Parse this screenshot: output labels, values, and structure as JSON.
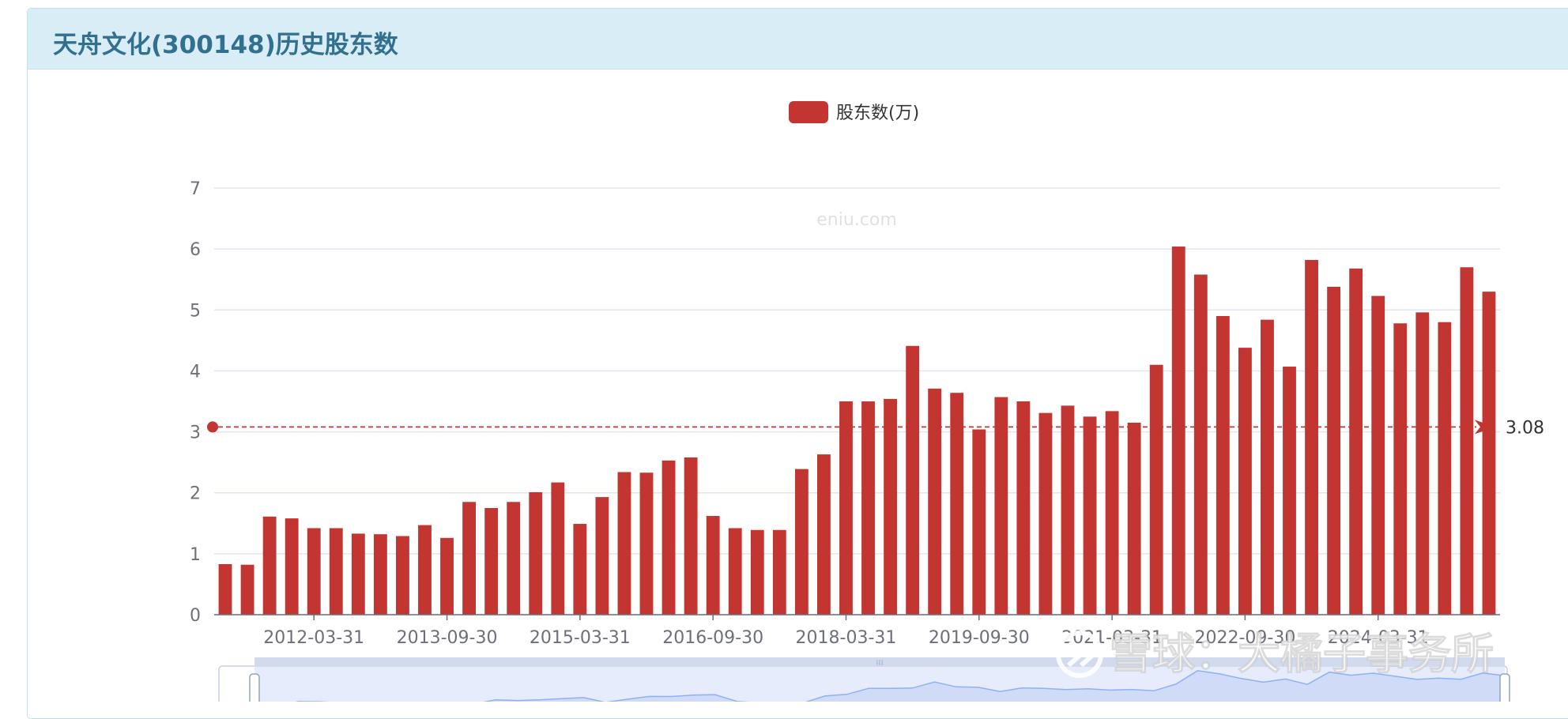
{
  "panel": {
    "title": "天舟文化(300148)历史股东数"
  },
  "watermarks": {
    "site": "eniu.com",
    "xueqiu": "雪球：大橘子事务所"
  },
  "colors": {
    "bar": "#c23531",
    "header_bg": "#d9edf7",
    "title": "#31708f",
    "grid": "#e0e6f1",
    "zoom_fill": "#dde6fa",
    "zoom_line": "#8fb0f7"
  },
  "chart_data": {
    "type": "bar",
    "legend": [
      "股东数(万)"
    ],
    "legend_position": "top-center",
    "ylim": [
      0,
      7
    ],
    "y_ticks": [
      0,
      1,
      2,
      3,
      4,
      5,
      6,
      7
    ],
    "x_tick_labels": [
      "2012-03-31",
      "2013-09-30",
      "2015-03-31",
      "2016-09-30",
      "2018-03-31",
      "2019-09-30",
      "2021-03-31",
      "2022-09-30",
      "2024-03-31"
    ],
    "x_tick_label_indices": [
      4,
      10,
      16,
      22,
      28,
      34,
      40,
      46,
      52
    ],
    "grid": true,
    "mark_line": {
      "value": 3.08,
      "label": "3.08",
      "style": "dashed"
    },
    "series": [
      {
        "name": "股东数(万)",
        "values": [
          0.83,
          0.82,
          1.61,
          1.58,
          1.42,
          1.42,
          1.33,
          1.32,
          1.29,
          1.47,
          1.26,
          1.85,
          1.75,
          1.85,
          2.01,
          2.17,
          1.49,
          1.93,
          2.34,
          2.33,
          2.53,
          2.58,
          1.62,
          1.42,
          1.39,
          1.39,
          2.39,
          2.63,
          3.5,
          3.5,
          3.54,
          4.41,
          3.71,
          3.64,
          3.04,
          3.57,
          3.5,
          3.31,
          3.43,
          3.25,
          3.34,
          3.15,
          4.1,
          6.04,
          5.58,
          4.9,
          4.38,
          4.84,
          4.07,
          5.82,
          5.38,
          5.68,
          5.23,
          4.78,
          4.96,
          4.8,
          5.7,
          5.3
        ]
      }
    ]
  }
}
